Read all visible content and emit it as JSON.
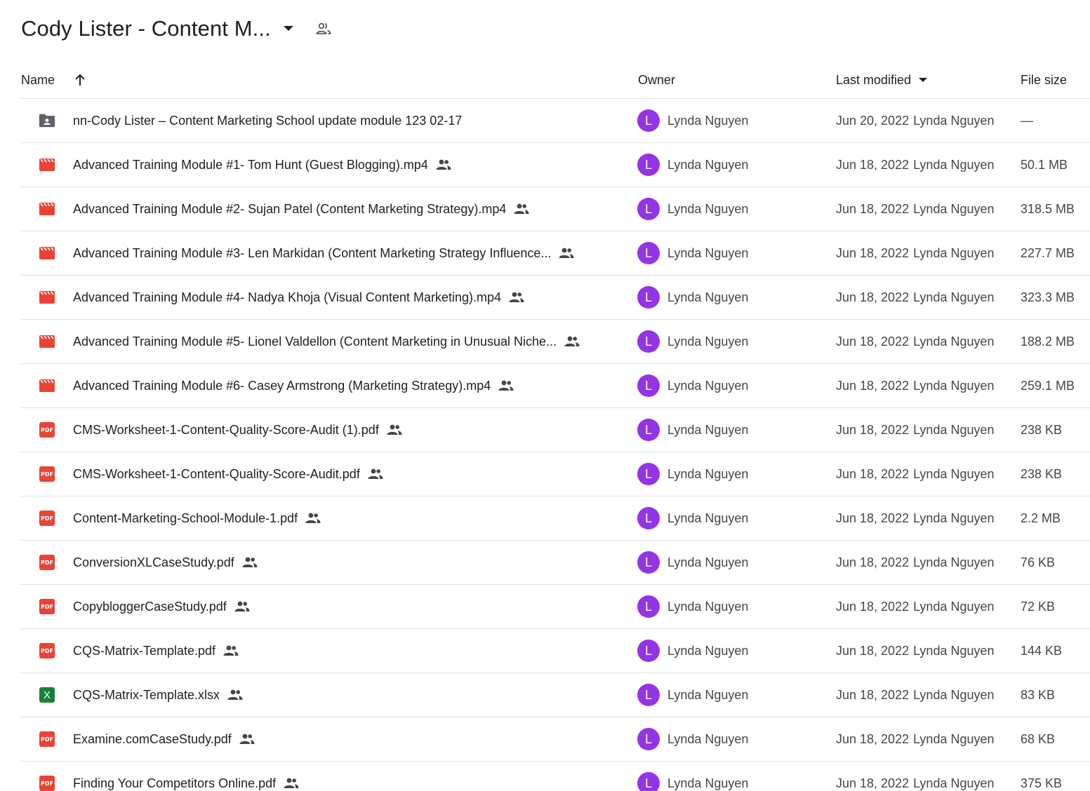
{
  "header": {
    "title": "Cody Lister - Content M..."
  },
  "columns": {
    "name": "Name",
    "owner": "Owner",
    "modified": "Last modified",
    "size": "File size"
  },
  "rows": [
    {
      "type": "folder",
      "name": "nn-Cody Lister – Content Marketing School update module 123 02-17",
      "shared": false,
      "owner_initial": "L",
      "owner": "Lynda Nguyen",
      "date": "Jun 20, 2022",
      "modified_by": "Lynda Nguyen",
      "size": "—"
    },
    {
      "type": "video",
      "name": "Advanced Training Module #1- Tom Hunt (Guest Blogging).mp4",
      "shared": true,
      "owner_initial": "L",
      "owner": "Lynda Nguyen",
      "date": "Jun 18, 2022",
      "modified_by": "Lynda Nguyen",
      "size": "50.1 MB"
    },
    {
      "type": "video",
      "name": "Advanced Training Module #2- Sujan Patel (Content Marketing Strategy).mp4",
      "shared": true,
      "owner_initial": "L",
      "owner": "Lynda Nguyen",
      "date": "Jun 18, 2022",
      "modified_by": "Lynda Nguyen",
      "size": "318.5 MB"
    },
    {
      "type": "video",
      "name": "Advanced Training Module #3- Len Markidan (Content Marketing Strategy   Influence...",
      "shared": true,
      "owner_initial": "L",
      "owner": "Lynda Nguyen",
      "date": "Jun 18, 2022",
      "modified_by": "Lynda Nguyen",
      "size": "227.7 MB"
    },
    {
      "type": "video",
      "name": "Advanced Training Module #4- Nadya Khoja (Visual Content Marketing).mp4",
      "shared": true,
      "owner_initial": "L",
      "owner": "Lynda Nguyen",
      "date": "Jun 18, 2022",
      "modified_by": "Lynda Nguyen",
      "size": "323.3 MB"
    },
    {
      "type": "video",
      "name": "Advanced Training Module #5- Lionel Valdellon (Content Marketing in Unusual Niche...",
      "shared": true,
      "owner_initial": "L",
      "owner": "Lynda Nguyen",
      "date": "Jun 18, 2022",
      "modified_by": "Lynda Nguyen",
      "size": "188.2 MB"
    },
    {
      "type": "video",
      "name": "Advanced Training Module #6- Casey Armstrong (Marketing Strategy).mp4",
      "shared": true,
      "owner_initial": "L",
      "owner": "Lynda Nguyen",
      "date": "Jun 18, 2022",
      "modified_by": "Lynda Nguyen",
      "size": "259.1 MB"
    },
    {
      "type": "pdf",
      "name": "CMS-Worksheet-1-Content-Quality-Score-Audit (1).pdf",
      "shared": true,
      "owner_initial": "L",
      "owner": "Lynda Nguyen",
      "date": "Jun 18, 2022",
      "modified_by": "Lynda Nguyen",
      "size": "238 KB"
    },
    {
      "type": "pdf",
      "name": "CMS-Worksheet-1-Content-Quality-Score-Audit.pdf",
      "shared": true,
      "owner_initial": "L",
      "owner": "Lynda Nguyen",
      "date": "Jun 18, 2022",
      "modified_by": "Lynda Nguyen",
      "size": "238 KB"
    },
    {
      "type": "pdf",
      "name": "Content-Marketing-School-Module-1.pdf",
      "shared": true,
      "owner_initial": "L",
      "owner": "Lynda Nguyen",
      "date": "Jun 18, 2022",
      "modified_by": "Lynda Nguyen",
      "size": "2.2 MB"
    },
    {
      "type": "pdf",
      "name": "ConversionXLCaseStudy.pdf",
      "shared": true,
      "owner_initial": "L",
      "owner": "Lynda Nguyen",
      "date": "Jun 18, 2022",
      "modified_by": "Lynda Nguyen",
      "size": "76 KB"
    },
    {
      "type": "pdf",
      "name": "CopybloggerCaseStudy.pdf",
      "shared": true,
      "owner_initial": "L",
      "owner": "Lynda Nguyen",
      "date": "Jun 18, 2022",
      "modified_by": "Lynda Nguyen",
      "size": "72 KB"
    },
    {
      "type": "pdf",
      "name": "CQS-Matrix-Template.pdf",
      "shared": true,
      "owner_initial": "L",
      "owner": "Lynda Nguyen",
      "date": "Jun 18, 2022",
      "modified_by": "Lynda Nguyen",
      "size": "144 KB"
    },
    {
      "type": "xlsx",
      "name": "CQS-Matrix-Template.xlsx",
      "shared": true,
      "owner_initial": "L",
      "owner": "Lynda Nguyen",
      "date": "Jun 18, 2022",
      "modified_by": "Lynda Nguyen",
      "size": "83 KB"
    },
    {
      "type": "pdf",
      "name": "Examine.comCaseStudy.pdf",
      "shared": true,
      "owner_initial": "L",
      "owner": "Lynda Nguyen",
      "date": "Jun 18, 2022",
      "modified_by": "Lynda Nguyen",
      "size": "68 KB"
    },
    {
      "type": "pdf",
      "name": "Finding Your Competitors Online.pdf",
      "shared": true,
      "owner_initial": "L",
      "owner": "Lynda Nguyen",
      "date": "Jun 18, 2022",
      "modified_by": "Lynda Nguyen",
      "size": "375 KB"
    }
  ],
  "icons": {
    "folder": "shared-folder-icon",
    "video": "video-file-icon",
    "pdf": "pdf-file-icon",
    "xlsx": "spreadsheet-file-icon",
    "pdf_label": "PDF",
    "xlsx_label": "X"
  },
  "colors": {
    "avatar": "#9334e6",
    "pdf": "#ea4335",
    "video": "#ea4335",
    "xlsx": "#188038",
    "folder": "#5f6368"
  }
}
